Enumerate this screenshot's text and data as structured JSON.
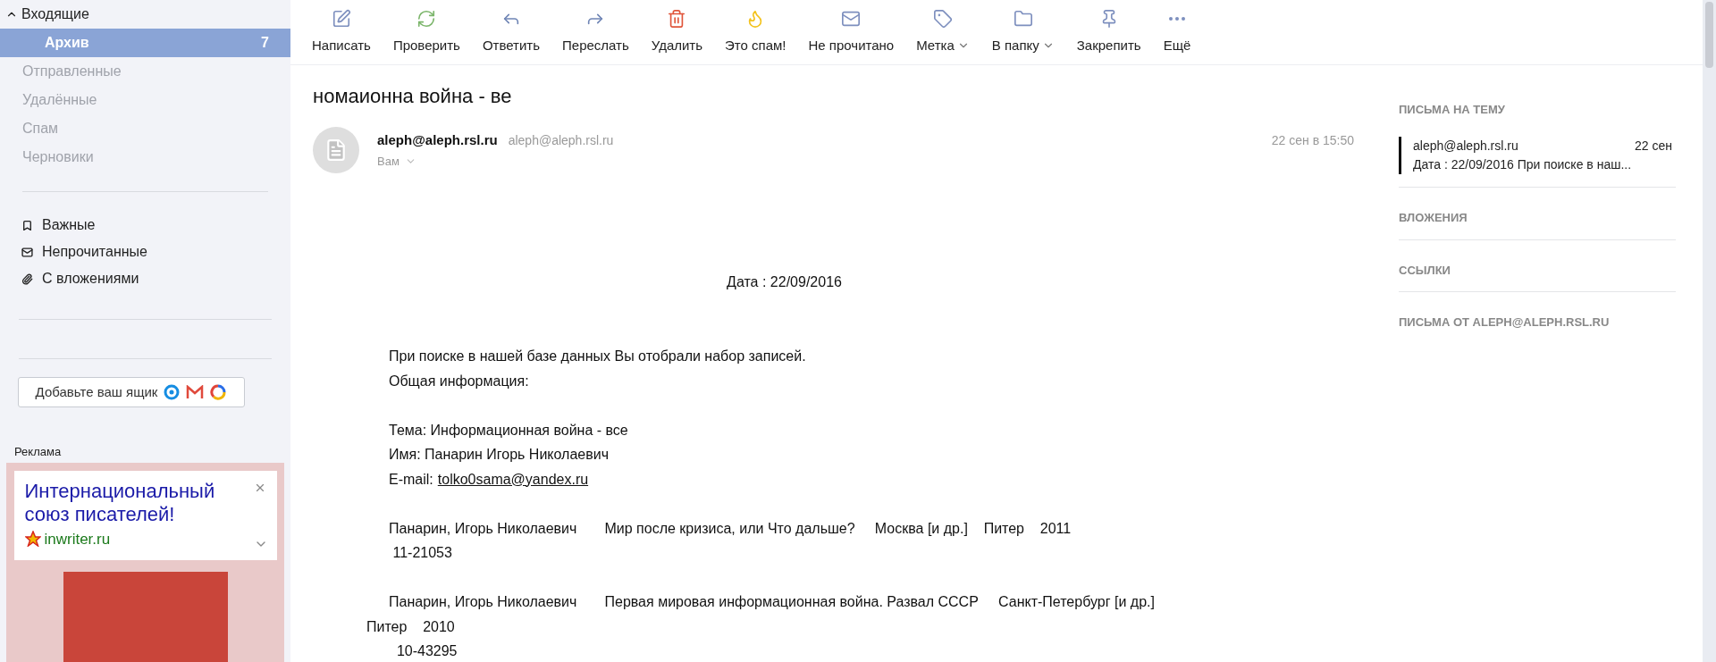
{
  "sidebar": {
    "inbox": {
      "label": "Входящие",
      "expanded": true
    },
    "folders": [
      {
        "label": "Архив",
        "count": "7",
        "selected": true,
        "sub": true
      },
      {
        "label": "Отправленные",
        "selected": false
      },
      {
        "label": "Удалённые",
        "selected": false
      },
      {
        "label": "Спам",
        "selected": false
      },
      {
        "label": "Черновики",
        "selected": false
      }
    ],
    "filters": [
      {
        "kind": "important",
        "label": "Важные"
      },
      {
        "kind": "unread",
        "label": "Непрочитанные"
      },
      {
        "kind": "attachments",
        "label": "С вложениями"
      }
    ],
    "add_mailbox": "Добавьте ваш ящик",
    "ad": {
      "label": "Реклама",
      "title": "Интернациональный союз писателей!",
      "domain": "inwriter.ru"
    }
  },
  "toolbar": [
    {
      "kind": "compose",
      "label": "Написать"
    },
    {
      "kind": "refresh",
      "label": "Проверить"
    },
    {
      "kind": "reply",
      "label": "Ответить"
    },
    {
      "kind": "forward",
      "label": "Переслать"
    },
    {
      "kind": "delete",
      "label": "Удалить"
    },
    {
      "kind": "spam",
      "label": "Это спам!"
    },
    {
      "kind": "unread",
      "label": "Не прочитано"
    },
    {
      "kind": "label",
      "label": "Метка",
      "dropdown": true
    },
    {
      "kind": "folder",
      "label": "В папку",
      "dropdown": true
    },
    {
      "kind": "pin",
      "label": "Закрепить"
    },
    {
      "kind": "more",
      "label": "Ещё"
    }
  ],
  "message": {
    "subject": "номаионна война - ве",
    "sender_name": "aleph@aleph.rsl.ru",
    "sender_email": "aleph@aleph.rsl.ru",
    "recipient": "Вам",
    "date": "22 сен в 15:50",
    "body": [
      {
        "kind": "center",
        "text": "Дата : 22/09/2016"
      },
      {
        "kind": "gap"
      },
      {
        "kind": "line",
        "text": "При поиске в нашей базе данных Вы отобрали набор записей."
      },
      {
        "kind": "line",
        "text": "Общая информация:"
      },
      {
        "kind": "gap"
      },
      {
        "kind": "line",
        "text": "Тема: Информационная война - все"
      },
      {
        "kind": "line",
        "text": "Имя: Панарин Игорь Николаевич"
      },
      {
        "kind": "email",
        "prefix": "E-mail:",
        "link": "tolko0sama@yandex.ru"
      },
      {
        "kind": "gap"
      },
      {
        "kind": "line",
        "text": "Панарин, Игорь Николаевич       Мир после кризиса, или Что дальше?     Москва [и др.]    Питер    2011"
      },
      {
        "kind": "line",
        "text": " 11-21053"
      },
      {
        "kind": "gap"
      },
      {
        "kind": "line",
        "text": "Панарин, Игорь Николаевич       Первая мировая информационная война. Развал СССР     Санкт-Петербург [и др.]"
      },
      {
        "kind": "outdent",
        "text": "Питер    2010"
      },
      {
        "kind": "line",
        "text": "  10-43295"
      }
    ]
  },
  "right_panel": {
    "thread_heading": "ПИСЬМА НА ТЕМУ",
    "thread": [
      {
        "sender": "aleph@aleph.rsl.ru",
        "date": "22 сен",
        "snippet": "Дата : 22/09/2016 При поиске в наш..."
      }
    ],
    "sections": [
      "ВЛОЖЕНИЯ",
      "ССЫЛКИ",
      "ПИСЬМА ОТ ALEPH@ALEPH.RSL.RU"
    ]
  }
}
